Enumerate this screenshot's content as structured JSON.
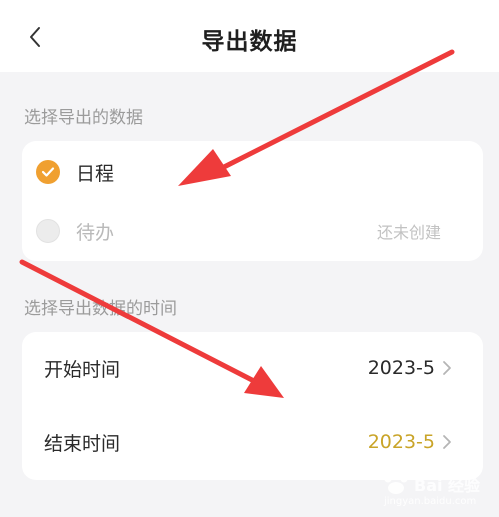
{
  "header": {
    "title": "导出数据",
    "back_icon": "chevron-left-icon"
  },
  "data_section": {
    "label": "选择导出的数据",
    "options": [
      {
        "label": "日程",
        "checked": true
      },
      {
        "label": "待办",
        "checked": false,
        "hint": "还未创建"
      }
    ]
  },
  "time_section": {
    "label": "选择导出数据的时间",
    "rows": [
      {
        "label": "开始时间",
        "value": "2023-5"
      },
      {
        "label": "结束时间",
        "value": "2023-5"
      }
    ]
  },
  "colors": {
    "accent": "#f0a030",
    "highlight_value": "#c9a428",
    "arrow": "#ee3b3b"
  },
  "watermark": {
    "brand": "Bai 经验",
    "url": "jingyan.baidu.com"
  }
}
